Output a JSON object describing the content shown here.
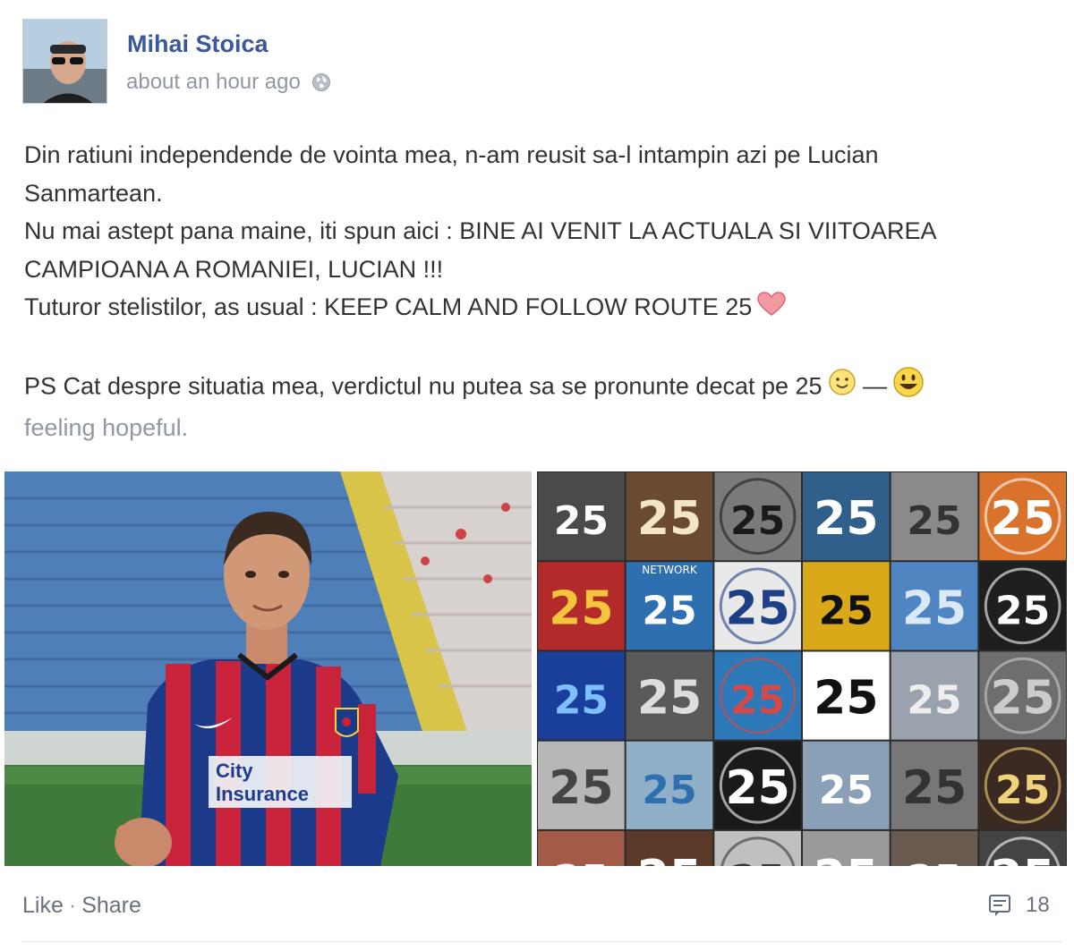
{
  "post": {
    "author": "Mihai Stoica",
    "timestamp": "about an hour ago",
    "privacy_icon": "globe-icon",
    "lines": [
      "Din ratiuni independende de vointa mea, n-am reusit sa-l intampin azi pe Lucian",
      "Sanmartean.",
      "Nu mai astept pana maine, iti spun aici : BINE AI VENIT LA ACTUALA SI VIITOAREA",
      "CAMPIOANA A ROMANIEI, LUCIAN !!!",
      "Tuturor stelistilor, as usual : KEEP CALM AND FOLLOW ROUTE 25"
    ],
    "ps_text": "PS Cat despre situatia mea, verdictul nu putea sa se pronunte decat pe 25",
    "ps_dash": "—",
    "feeling": "feeling hopeful.",
    "icons": {
      "heart": "heart-icon",
      "smile": "smile-emoji-icon",
      "feeling": "grin-emoji-icon"
    }
  },
  "photos": {
    "left": {
      "shirt_text_1": "City",
      "shirt_text_2": "Insurance"
    },
    "mosaic_labels": [
      "25",
      "25",
      "25",
      "25",
      "25",
      "25",
      "25",
      "25",
      "25",
      "25",
      "25",
      "25",
      "25",
      "25",
      "25",
      "25",
      "25",
      "25",
      "25",
      "25",
      "25",
      "25",
      "25",
      "25"
    ],
    "mosaic_small": "NETWORK"
  },
  "footer": {
    "like": "Like",
    "separator": "·",
    "share": "Share",
    "comment_count": "18",
    "comment_icon": "comment-icon"
  },
  "colors": {
    "author_link": "#3b5998",
    "meta_text": "#9197a3",
    "heart": "#e8737f"
  }
}
